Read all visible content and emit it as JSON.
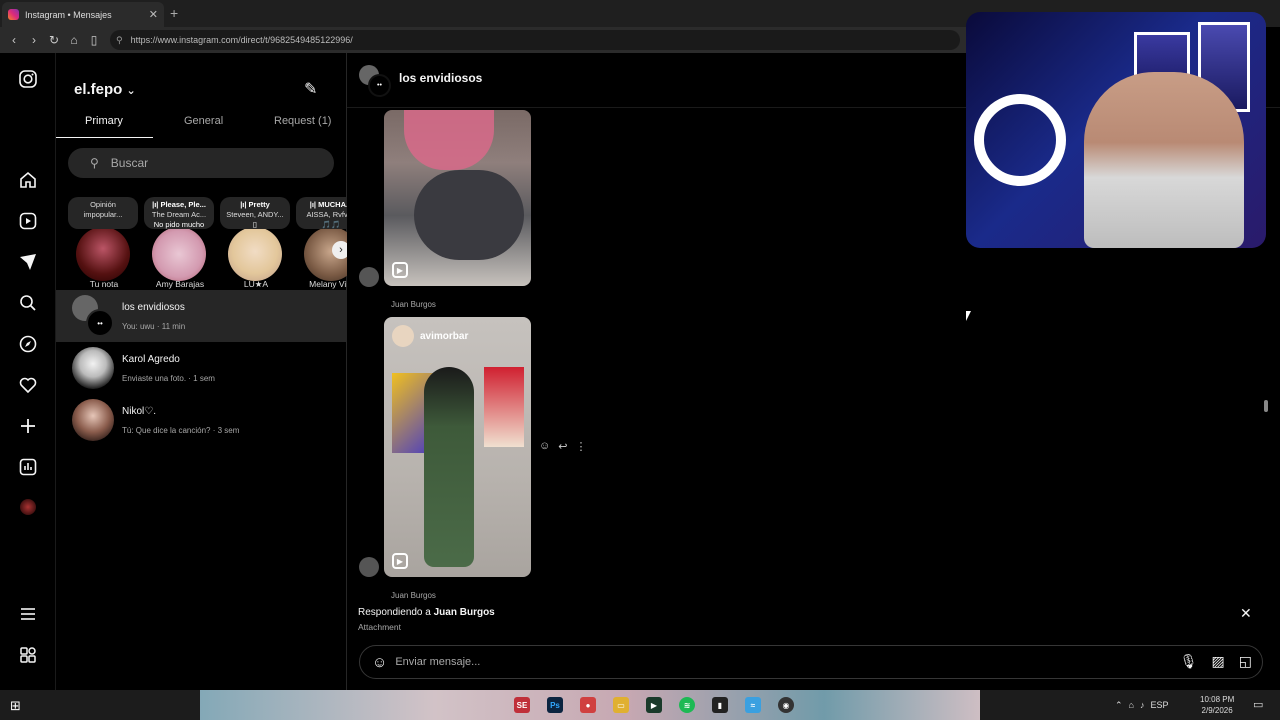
{
  "browser": {
    "tab_title": "Instagram • Mensajes",
    "tab_close": "✕",
    "new_tab": "+",
    "url": "https://www.instagram.com/direct/t/9682549485122996/",
    "nav": {
      "back": "‹",
      "forward": "›",
      "reload": "↻",
      "home": "⌂",
      "bookmark": "▯"
    }
  },
  "leftnav": {
    "icons": [
      "instagram-logo",
      "home",
      "reels",
      "messages",
      "search",
      "explore",
      "notifications",
      "create",
      "dashboard",
      "profile",
      "more",
      "meta"
    ]
  },
  "inbox": {
    "username": "el.fepo",
    "username_chevron": "⌄",
    "compose_icon": "✎",
    "tabs": [
      {
        "label": "Primary",
        "active": true
      },
      {
        "label": "General",
        "active": false
      },
      {
        "label": "Request (1)",
        "active": false
      }
    ],
    "search_placeholder": "Buscar",
    "notes": [
      {
        "bubble_line1": "Opinión",
        "bubble_line2": "impopular...",
        "bubble_line3": "",
        "name": "Tu nota"
      },
      {
        "bubble_line1": "|ı| Please, Ple...",
        "bubble_line2": "The Dream Ac...",
        "bubble_line3": "No pido mucho",
        "name": "Amy Barajas"
      },
      {
        "bubble_line1": "|ı| Pretty",
        "bubble_line2": "Steveen, ANDY...",
        "bubble_line3": "▯",
        "name": "LU★A"
      },
      {
        "bubble_line1": "|ı| MUCHA...",
        "bubble_line2": "AISSA, Rvfv,...",
        "bubble_line3": "🎵🎵",
        "name": "Melany Ville"
      }
    ],
    "notes_next": "›",
    "conversations": [
      {
        "name": "los envidiosos",
        "preview": "You: uwu · 11 min",
        "selected": true
      },
      {
        "name": "Karol Agredo",
        "preview": "Enviaste una foto. · 1 sem",
        "selected": false
      },
      {
        "name": "Nikol♡.",
        "preview": "Tú: Que dice la canción? · 3 sem",
        "selected": false
      }
    ]
  },
  "chat": {
    "title": "los envidiosos",
    "messages": [
      {
        "sender": "Juan Burgos",
        "type": "reel"
      },
      {
        "sender": "Juan Burgos",
        "type": "reel",
        "reel_author": "avimorbar"
      }
    ],
    "message_actions": {
      "react": "☺",
      "reply": "↩",
      "more": "⋮"
    },
    "reply": {
      "prefix": "Respondiendo a ",
      "to": "Juan Burgos",
      "attachment": "Attachment",
      "close": "✕"
    },
    "composer": {
      "placeholder": "Enviar mensaje...",
      "emoji_icon": "☺",
      "mic_icon": "🎙",
      "image_icon": "▨",
      "sticker_icon": "◱"
    }
  },
  "taskbar": {
    "language": "ESP",
    "time": "10:08 PM",
    "date": "2/9/2026"
  },
  "colors": {
    "background": "#000000",
    "panel_border": "#262626",
    "selected_row": "#262626",
    "secondary_text": "#a8a8a8"
  }
}
